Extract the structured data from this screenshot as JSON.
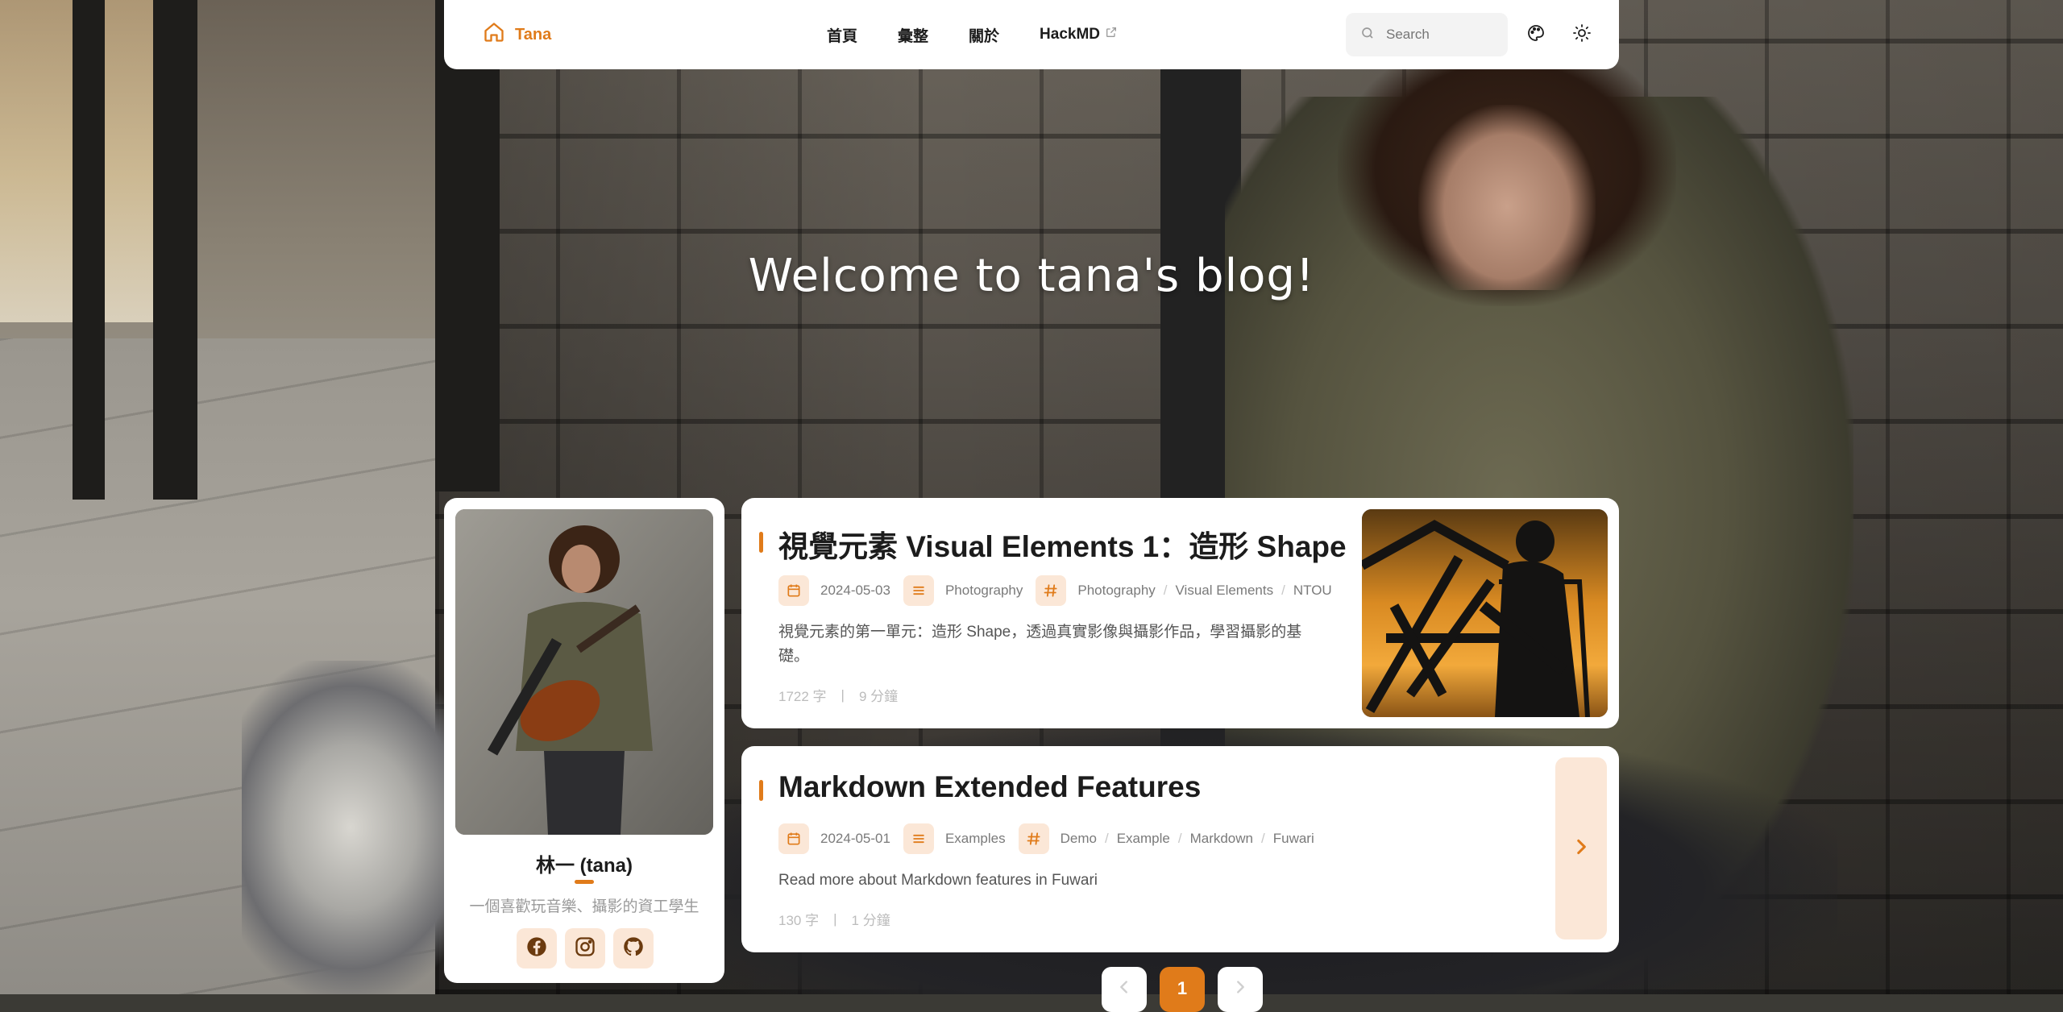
{
  "nav": {
    "brand": "Tana",
    "links": [
      "首頁",
      "彙整",
      "關於",
      "HackMD"
    ],
    "search_placeholder": "Search"
  },
  "hero": {
    "title": "Welcome to tana's blog!"
  },
  "profile": {
    "name": "林一 (tana)",
    "bio": "一個喜歡玩音樂、攝影的資工學生",
    "socials": [
      "facebook-icon",
      "instagram-icon",
      "github-icon"
    ]
  },
  "posts": [
    {
      "title": "視覺元素 Visual Elements 1：造形 Shape",
      "date": "2024-05-03",
      "category": "Photography",
      "tags": [
        "Photography",
        "Visual Elements",
        "NTOU"
      ],
      "description": "視覺元素的第一單元：造形 Shape，透過真實影像與攝影作品，學習攝影的基礎。",
      "words": "1722 字",
      "reading_time": "9 分鐘"
    },
    {
      "title": "Markdown Extended Features",
      "date": "2024-05-01",
      "category": "Examples",
      "tags": [
        "Demo",
        "Example",
        "Markdown",
        "Fuwari"
      ],
      "description": "Read more about Markdown features in Fuwari",
      "words": "130 字",
      "reading_time": "1 分鐘"
    }
  ],
  "pagination": {
    "current": "1"
  },
  "colors": {
    "accent": "#e07b1a",
    "accent_soft": "#fbe7d7"
  }
}
